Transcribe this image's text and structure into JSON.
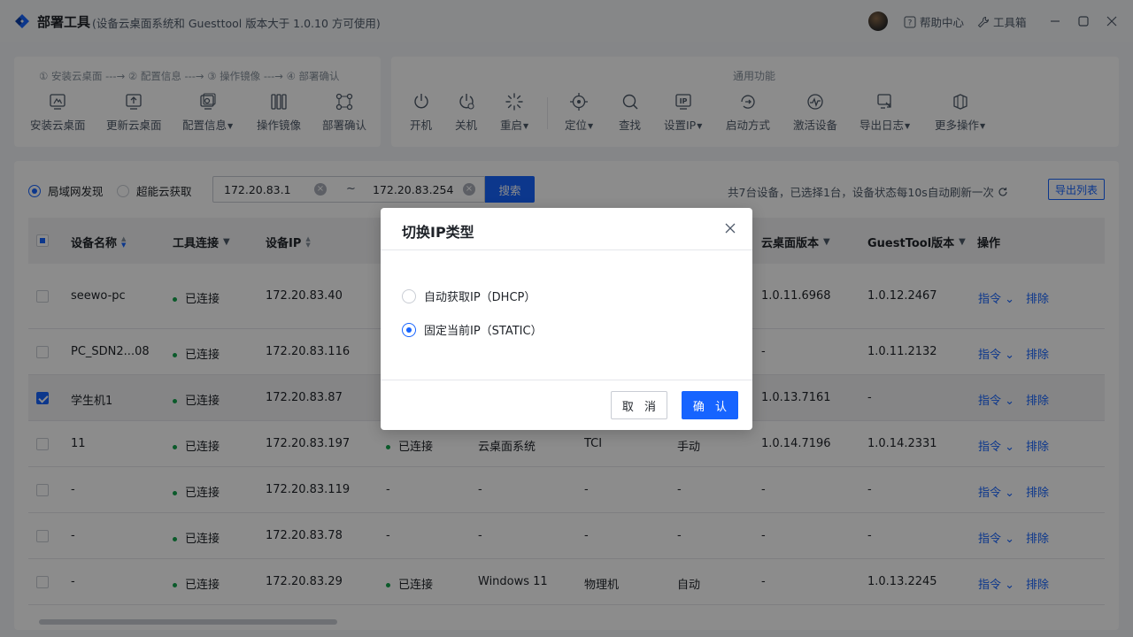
{
  "app": {
    "title": "部署工具",
    "subtitle": "(设备云桌面系统和 Guesttool 版本大于 1.0.10 方可使用)",
    "help": "帮助中心",
    "toolbox": "工具箱",
    "icons": {
      "logo": "app-logo-icon",
      "help": "help-icon",
      "toolbox": "wrench-icon"
    }
  },
  "deploy": {
    "steps": "① 安装云桌面 ---→ ② 配置信息 ---→ ③ 操作镜像 ---→ ④ 部署确认",
    "tools": [
      "安装云桌面",
      "更新云桌面",
      "配置信息",
      "操作镜像",
      "部署确认"
    ]
  },
  "common": {
    "title": "通用功能",
    "tools": [
      "开机",
      "关机",
      "重启",
      "定位",
      "查找",
      "设置IP",
      "启动方式",
      "激活设备",
      "导出日志",
      "更多操作"
    ]
  },
  "filter": {
    "lan": "局域网发现",
    "cloud": "超能云获取",
    "ip_start": "172.20.83.1",
    "ip_end": "172.20.83.254",
    "tilde": "~",
    "search": "搜索",
    "summary": "共7台设备，已选择1台，设备状态每10s自动刷新一次",
    "export": "导出列表"
  },
  "table": {
    "headers": {
      "name": "设备名称",
      "tool_conn": "工具连接",
      "ip": "设备IP",
      "desk_ver": "云桌面版本",
      "guest_ver": "GuestTool版本",
      "ops": "操作"
    },
    "rows": [
      {
        "name": "seewo-pc",
        "tool": "已连接",
        "ip": "172.20.83.40",
        "c1": "",
        "c2": "",
        "c3": "",
        "c4": "",
        "desk": "1.0.11.6968",
        "guest": "1.0.12.2467",
        "checked": false
      },
      {
        "name": "PC_SDN2...08",
        "tool": "已连接",
        "ip": "172.20.83.116",
        "c1": "",
        "c2": "",
        "c3": "",
        "c4": "",
        "desk": "-",
        "guest": "1.0.11.2132",
        "checked": false
      },
      {
        "name": "学生机1",
        "tool": "已连接",
        "ip": "172.20.83.87",
        "c1": "",
        "c2": "",
        "c3": "",
        "c4": "",
        "desk": "1.0.13.7161",
        "guest": "-",
        "checked": true
      },
      {
        "name": "11",
        "tool": "已连接",
        "ip": "172.20.83.197",
        "c1": "已连接",
        "c2": "云桌面系统",
        "c3": "TCI",
        "c4": "手动",
        "desk": "1.0.14.7196",
        "guest": "1.0.14.2331",
        "checked": false
      },
      {
        "name": "-",
        "tool": "已连接",
        "ip": "172.20.83.119",
        "c1": "-",
        "c2": "-",
        "c3": "-",
        "c4": "-",
        "desk": "-",
        "guest": "-",
        "checked": false
      },
      {
        "name": "-",
        "tool": "已连接",
        "ip": "172.20.83.78",
        "c1": "-",
        "c2": "-",
        "c3": "-",
        "c4": "-",
        "desk": "-",
        "guest": "-",
        "checked": false
      },
      {
        "name": "-",
        "tool": "已连接",
        "ip": "172.20.83.29",
        "c1": "已连接",
        "c2": "Windows 11",
        "c3": "物理机",
        "c4": "自动",
        "desk": "-",
        "guest": "1.0.13.2245",
        "checked": false
      }
    ],
    "op_cmd": "指令",
    "op_remove": "排除"
  },
  "modal": {
    "title": "切换IP类型",
    "option_dhcp": "自动获取IP（DHCP）",
    "option_static": "固定当前IP（STATIC）",
    "selected": "static",
    "cancel": "取 消",
    "confirm": "确 认"
  },
  "colors": {
    "accent": "#1664ff",
    "status_ok": "#14a44d"
  }
}
